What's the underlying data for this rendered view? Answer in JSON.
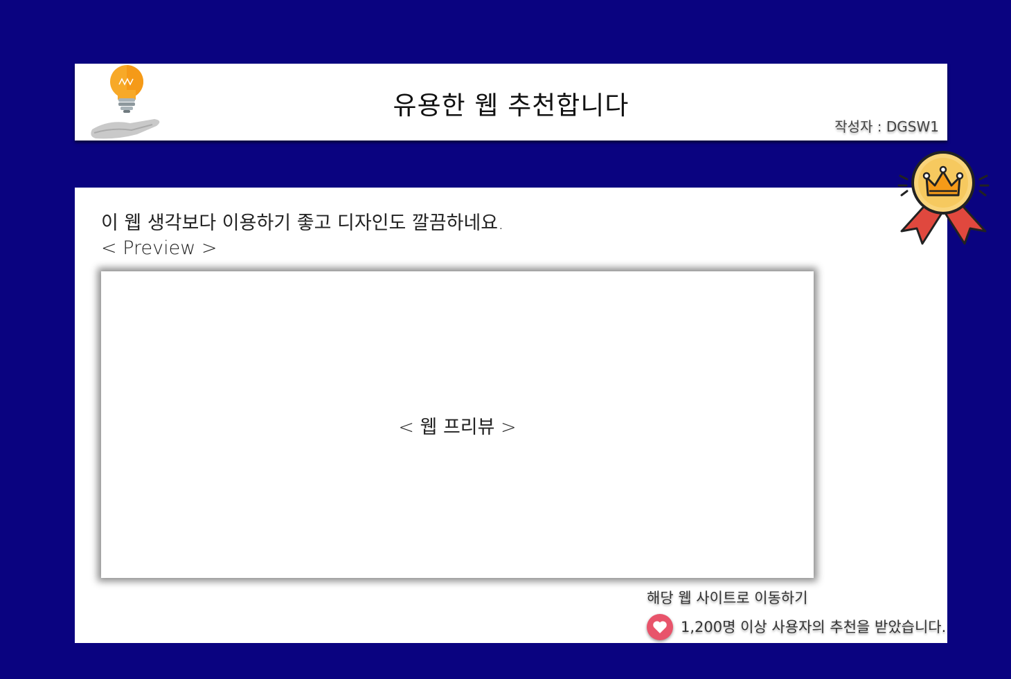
{
  "header": {
    "title": "유용한 웹 추천합니다",
    "author": "작성자 : DGSW1",
    "logo_icon": "lightbulb-hand-icon"
  },
  "main": {
    "description": "이 웹 생각보다 이용하기 좋고 디자인도 깔끔하네요.",
    "preview_label": "< Preview >",
    "preview_placeholder": "< 웹 프리뷰 >",
    "visit_link": "해당 웹 사이트로 이동하기",
    "recommendation_text": "1,200명 이상 사용자의 추천을 받았습니다.",
    "like_icon": "heart-icon",
    "badge_icon": "award-medal-crown-icon"
  },
  "colors": {
    "background": "#0a0380",
    "card": "#ffffff",
    "heart": "#e8546b",
    "bulb": "#f7a928",
    "medal_ribbon": "#e0483e",
    "medal_face": "#f9d47a"
  }
}
